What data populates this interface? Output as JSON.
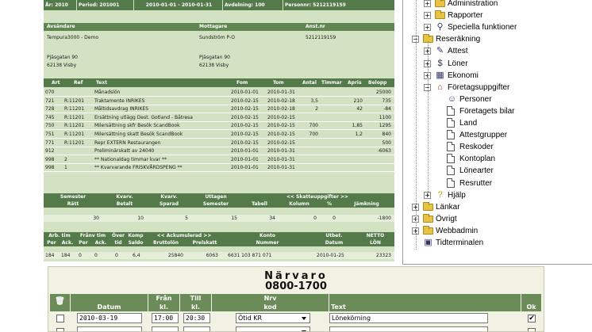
{
  "slip": {
    "top_fields": [
      "År: 2010",
      "Period: 201001",
      "2010-01-01 - 2010-01-31",
      "Avdelning: 100",
      "Personnr: 5212119159"
    ],
    "party_headers": [
      "Avsändare",
      "Mottagare",
      "Anst.nr"
    ],
    "sender": [
      "Tempura3000 - Demo",
      "Pjäsgatan 90",
      "62138 Visby"
    ],
    "receiver": [
      "Sundström P-O",
      "Pjäsgatan 90",
      "62138 Visby"
    ],
    "employee_no": "5212119159",
    "columns": [
      "Art",
      "Ref",
      "Text",
      "Fom",
      "Tom",
      "Antal",
      "Timmar",
      "Apris",
      "Belopp"
    ],
    "rows": [
      [
        "070",
        "",
        "Månadslön",
        "2010-01-01",
        "2010-01-31",
        "",
        "",
        "",
        "25000"
      ],
      [
        "721",
        "R:11201",
        "Traktamente INRIKES",
        "2010-02-15",
        "2010-02-18",
        "3,5",
        "",
        "210",
        "735"
      ],
      [
        "728",
        "R:11201",
        "Måltidsavdrag INRIKES",
        "2010-02-15",
        "2010-02-18",
        "2",
        "",
        "42",
        "-84"
      ],
      [
        "745",
        "R:11201",
        "Ersättning utlägg Dest. Gotland - Båtresa",
        "2010-02-15",
        "2010-02-15",
        "",
        "",
        "",
        "1100"
      ],
      [
        "750",
        "R:11201",
        "Milersättning skfr Besök ScandBook",
        "2010-02-15",
        "2010-02-15",
        "700",
        "",
        "1,85",
        "1295"
      ],
      [
        "751",
        "R:11201",
        "Milersättning skatt Besök ScandBook",
        "2010-02-15",
        "2010-02-15",
        "700",
        "",
        "1,2",
        "840"
      ],
      [
        "771",
        "R:11201",
        "Repr EXTERN Restaurangen",
        "2010-02-15",
        "2010-02-15",
        "",
        "",
        "",
        "500"
      ],
      [
        "912",
        "",
        "Preliminärskatt av 24040",
        "2010-01-01",
        "2010-01-31",
        "",
        "",
        "",
        "-6063"
      ],
      [
        "998",
        "2",
        "** Nationaldag timmar kvar **",
        "2010-01-01",
        "2010-01-31",
        "",
        "",
        "",
        ""
      ],
      [
        "998",
        "1",
        "** Kvarvarande FRISKVÅRDSPENG **",
        "2010-01-01",
        "2010-01-31",
        "",
        "",
        "",
        ""
      ]
    ],
    "vac_group_labels": [
      "Semester",
      "Kvarv.",
      "Kvarv.",
      "Uttagen",
      "<< Skatteuppgifter >>"
    ],
    "vac_sub_labels": [
      "Rätt",
      "Betalt",
      "Sparad",
      "Semester",
      "Tabell",
      "Kolumn",
      "%",
      "Jämkning"
    ],
    "vac_values": [
      "30",
      "10",
      "5",
      "15",
      "34",
      "0",
      "0",
      "-1800"
    ],
    "acc_group_labels": [
      "Arb. tim",
      "Frånv tim",
      "Över",
      "Komp",
      "<< Ackumulerad >>",
      "Konto",
      "Utbet.",
      "NETTO"
    ],
    "acc_sub_labels": [
      "Per",
      "Ack.",
      "Per",
      "Ack.",
      "tid",
      "Saldo",
      "Bruttolön",
      "Prelskatt",
      "Nummer",
      "Datum",
      "LÖN"
    ],
    "acc_values": [
      "184",
      "184",
      "0",
      "0",
      "0",
      "6,4",
      "25840",
      "6063",
      "6631 103 871 071",
      "2010-01-25",
      "23323"
    ]
  },
  "tree": {
    "items": [
      {
        "label": "Administration",
        "icon": "admin-icon"
      },
      {
        "label": "Rapporter",
        "icon": "folder-icon"
      },
      {
        "label": "Speciella funktioner",
        "icon": "binoculars-icon"
      },
      {
        "label": "Reseräkning",
        "icon": "folder-open-icon"
      },
      {
        "label": "Attest",
        "icon": "attest-icon"
      },
      {
        "label": "Löner",
        "icon": "money-icon"
      },
      {
        "label": "Ekonomi",
        "icon": "ekonomi-icon"
      },
      {
        "label": "Företagsuppgifter",
        "icon": "house-icon"
      },
      {
        "label": "Personer",
        "icon": "persons-icon"
      },
      {
        "label": "Företagets bilar",
        "icon": "document-icon"
      },
      {
        "label": "Land",
        "icon": "document-icon"
      },
      {
        "label": "Attestgrupper",
        "icon": "document-icon"
      },
      {
        "label": "Reskoder",
        "icon": "document-icon"
      },
      {
        "label": "Kontoplan",
        "icon": "document-icon"
      },
      {
        "label": "Lönearter",
        "icon": "document-icon"
      },
      {
        "label": "Resrutter",
        "icon": "document-icon"
      },
      {
        "label": "Hjälp",
        "icon": "help-icon"
      },
      {
        "label": "Länkar",
        "icon": "folder-icon"
      },
      {
        "label": "Övrigt",
        "icon": "folder-icon"
      },
      {
        "label": "Webbadmin",
        "icon": "folder-icon"
      },
      {
        "label": "Tidterminalen",
        "icon": "terminal-icon"
      }
    ]
  },
  "form": {
    "title": "Närvaro",
    "hours": "0800-1700",
    "columns": [
      {
        "top": "",
        "bottom": "Datum"
      },
      {
        "top": "Från",
        "bottom": "kl."
      },
      {
        "top": "Till",
        "bottom": "kl."
      },
      {
        "top": "Nrv",
        "bottom": "kod"
      },
      {
        "top": "",
        "bottom": "Text"
      },
      {
        "top": "",
        "bottom": "Ok"
      }
    ],
    "row1": {
      "date": "2010-03-19",
      "from": "17:00",
      "to": "20:30",
      "code": "Ötid KR",
      "text": "Lönekörning",
      "ok": "✔"
    },
    "row2": {
      "date": "",
      "from": "",
      "to": "",
      "code": "",
      "text": "",
      "ok": ""
    }
  },
  "colors": {
    "green_dark": "#557a4a",
    "green_light": "#d4e2c4",
    "folder": "#e8c244"
  }
}
